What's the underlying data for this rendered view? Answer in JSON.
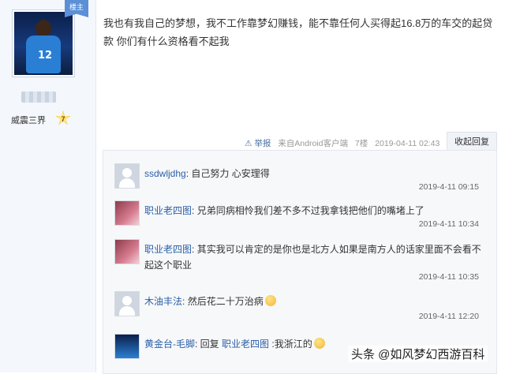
{
  "user": {
    "badge": "楼主",
    "level_name": "威震三界",
    "level_number": "7"
  },
  "post": {
    "text": "我也有我自己的梦想，我不工作靠梦幻赚钱，能不靠任何人买得起16.8万的车交的起贷款 你们有什么资格看不起我",
    "report": "举报",
    "source": "来自Android客户端",
    "floor": "7楼",
    "time": "2019-04-11 02:43",
    "collapse_label": "收起回复"
  },
  "replies": [
    {
      "user": "ssdwljdhg",
      "text": "自己努力 心安理得",
      "time": "2019-4-11 09:15",
      "avatar": "default-avatar"
    },
    {
      "user": "职业老四图",
      "text": "兄弟同病相怜我们差不多不过我拿钱把他们的嘴堵上了",
      "time": "2019-4-11 10:34",
      "avatar": "girl-avatar"
    },
    {
      "user": "职业老四图",
      "text": "其实我可以肯定的是你也是北方人如果是南方人的话家里面不会看不起这个职业",
      "time": "2019-4-11 10:35",
      "avatar": "girl-avatar"
    },
    {
      "user": "木油丰法",
      "text": "然后花二十万治病",
      "time": "2019-4-11 12:20",
      "avatar": "default-avatar"
    },
    {
      "user": "黄金台-毛脚",
      "prefix": "回复 ",
      "target": "职业老四图",
      "text": ":我浙江的",
      "avatar": "player-avatar"
    }
  ],
  "watermark": "头条 @如风梦幻西游百科"
}
